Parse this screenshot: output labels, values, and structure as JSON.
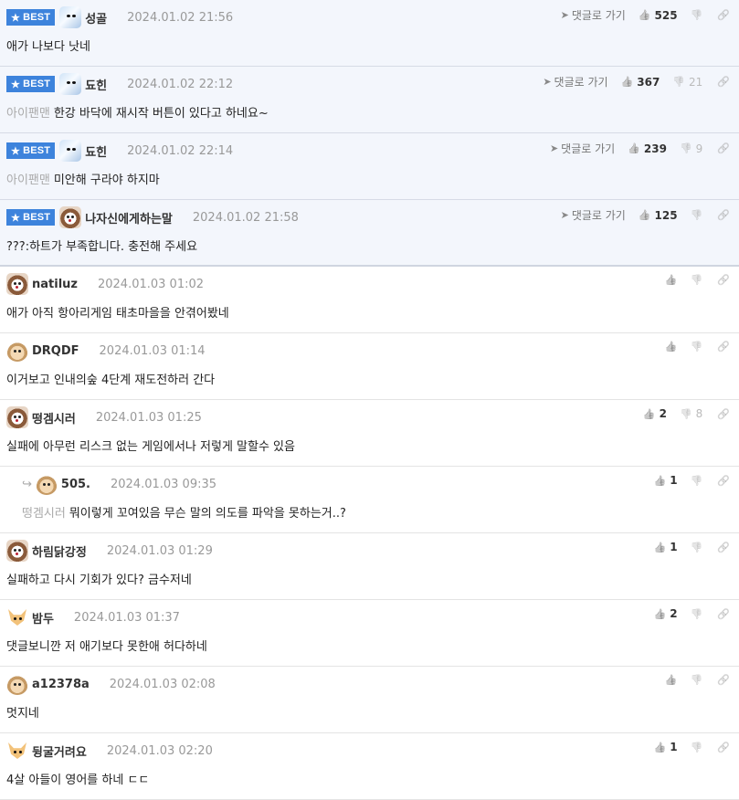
{
  "labels": {
    "best": "BEST",
    "goto": "댓글로 가기"
  },
  "comments": [
    {
      "best": true,
      "avatar": "cat",
      "nick": "성골",
      "date": "2024.01.02 21:56",
      "mention": "",
      "text": "애가 나보다 낫네",
      "likes": "525",
      "dislikes": "",
      "goto": true,
      "top": 0
    },
    {
      "best": true,
      "avatar": "cat",
      "nick": "됴힌",
      "date": "2024.01.02 22:12",
      "mention": "아이팬맨",
      "text": "한강 바닥에 재시작 버튼이 있다고 하네요~",
      "likes": "367",
      "dislikes": "21",
      "goto": true
    },
    {
      "best": true,
      "avatar": "cat",
      "nick": "됴힌",
      "date": "2024.01.02 22:14",
      "mention": "아이팬맨",
      "text": "미안해 구라야 하지마",
      "likes": "239",
      "dislikes": "9",
      "goto": true
    },
    {
      "best": true,
      "avatar": "dog",
      "nick": "나자신에게하는말",
      "date": "2024.01.02 21:58",
      "mention": "",
      "text": "???:하트가 부족합니다. 충전해 주세요",
      "likes": "125",
      "dislikes": "",
      "goto": true,
      "last": true
    },
    {
      "best": false,
      "avatar": "dog",
      "nick": "natiluz",
      "date": "2024.01.03 01:02",
      "mention": "",
      "text": "애가 아직 항아리게임 태초마을을 안겪어봤네",
      "likes": "",
      "dislikes": ""
    },
    {
      "best": false,
      "avatar": "pup",
      "nick": "DRQDF",
      "date": "2024.01.03 01:14",
      "mention": "",
      "text": "이거보고 인내의숲 4단계 재도전하러 간다",
      "likes": "",
      "dislikes": ""
    },
    {
      "best": false,
      "avatar": "dog",
      "nick": "떵겜시러",
      "date": "2024.01.03 01:25",
      "mention": "",
      "text": "실패에 아무런 리스크 없는 게임에서나 저렇게 말할수 있음",
      "likes": "2",
      "dislikes": "8"
    },
    {
      "best": false,
      "reply": true,
      "avatar": "pup",
      "nick": "505.",
      "date": "2024.01.03 09:35",
      "mention": "떵겜시러",
      "text": "뭐이렇게 꼬여있음 무슨 말의 의도를 파악을 못하는거..?",
      "likes": "1",
      "dislikes": ""
    },
    {
      "best": false,
      "avatar": "dog",
      "nick": "하림닭강정",
      "date": "2024.01.03 01:29",
      "mention": "",
      "text": "실패하고 다시 기회가 있다? 금수저네",
      "likes": "1",
      "dislikes": ""
    },
    {
      "best": false,
      "avatar": "fox",
      "nick": "밤두",
      "date": "2024.01.03 01:37",
      "mention": "",
      "text": "댓글보니깐 저 애기보다 못한애 허다하네",
      "likes": "2",
      "dislikes": ""
    },
    {
      "best": false,
      "avatar": "pup",
      "nick": "a12378a",
      "date": "2024.01.03 02:08",
      "mention": "",
      "text": "멋지네",
      "likes": "",
      "dislikes": ""
    },
    {
      "best": false,
      "avatar": "fox",
      "nick": "뒹굴거려요",
      "date": "2024.01.03 02:20",
      "mention": "",
      "text": "4살 아들이 영어를 하네 ㄷㄷ",
      "likes": "1",
      "dislikes": ""
    }
  ]
}
